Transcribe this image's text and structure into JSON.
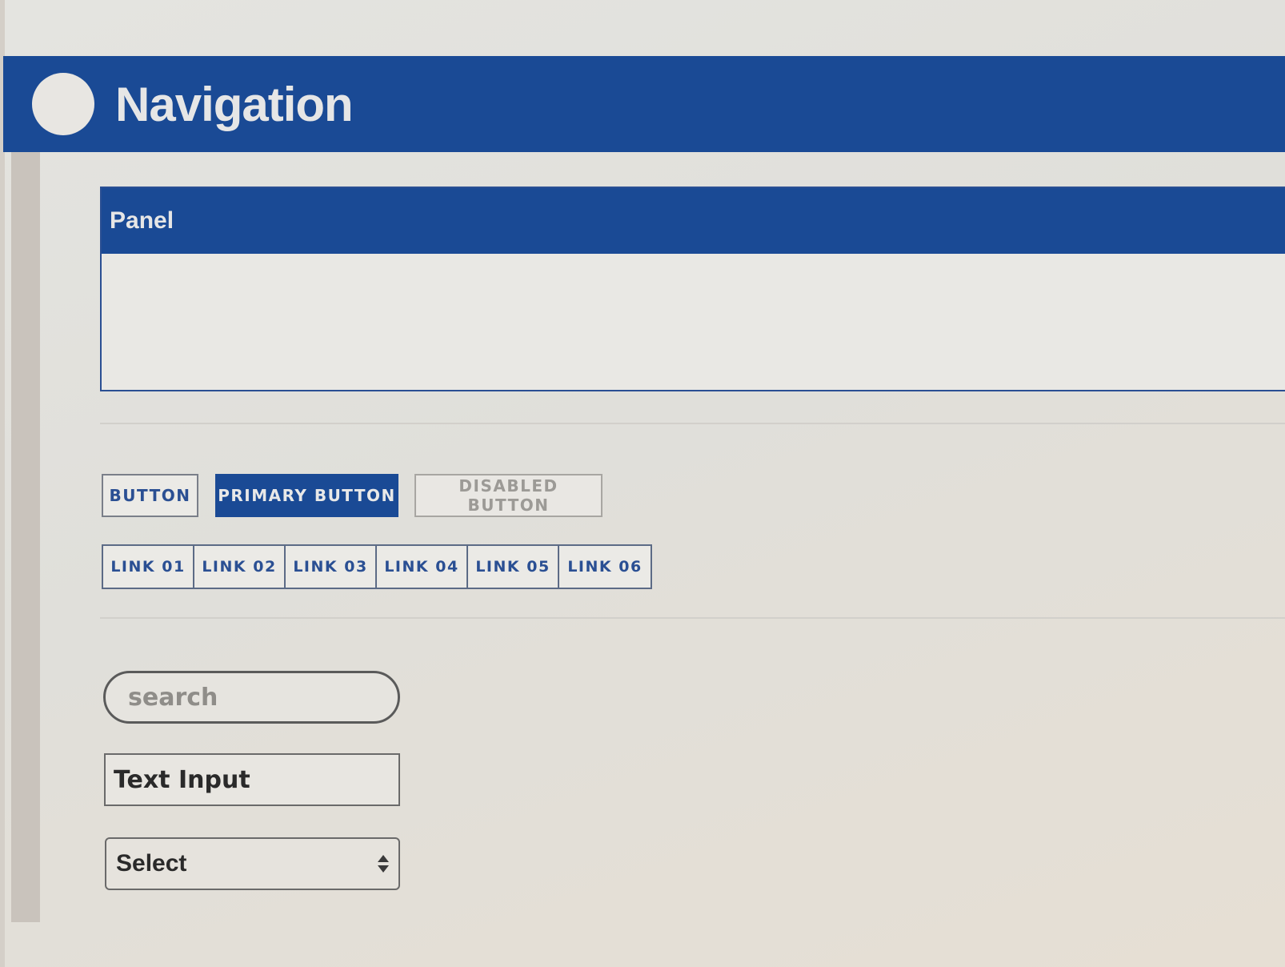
{
  "navigation": {
    "title": "Navigation"
  },
  "panel": {
    "title": "Panel"
  },
  "buttons": {
    "default_label": "BUTTON",
    "primary_label": "PRIMARY BUTTON",
    "disabled_label": "DISABLED BUTTON"
  },
  "links": [
    {
      "label": "LINK 01"
    },
    {
      "label": "LINK 02"
    },
    {
      "label": "LINK 03"
    },
    {
      "label": "LINK 04"
    },
    {
      "label": "LINK 05"
    },
    {
      "label": "LINK 06"
    }
  ],
  "search": {
    "placeholder": "search",
    "value": ""
  },
  "text_input": {
    "value": "Text Input"
  },
  "select": {
    "selected": "Select"
  },
  "colors": {
    "brand_blue": "#1a4a95",
    "link_blue": "#2a4f93",
    "disabled_gray": "#9c9a96"
  },
  "icons": {
    "logo": "circle-logo-icon",
    "select_arrows": "up-down-arrows-icon"
  }
}
